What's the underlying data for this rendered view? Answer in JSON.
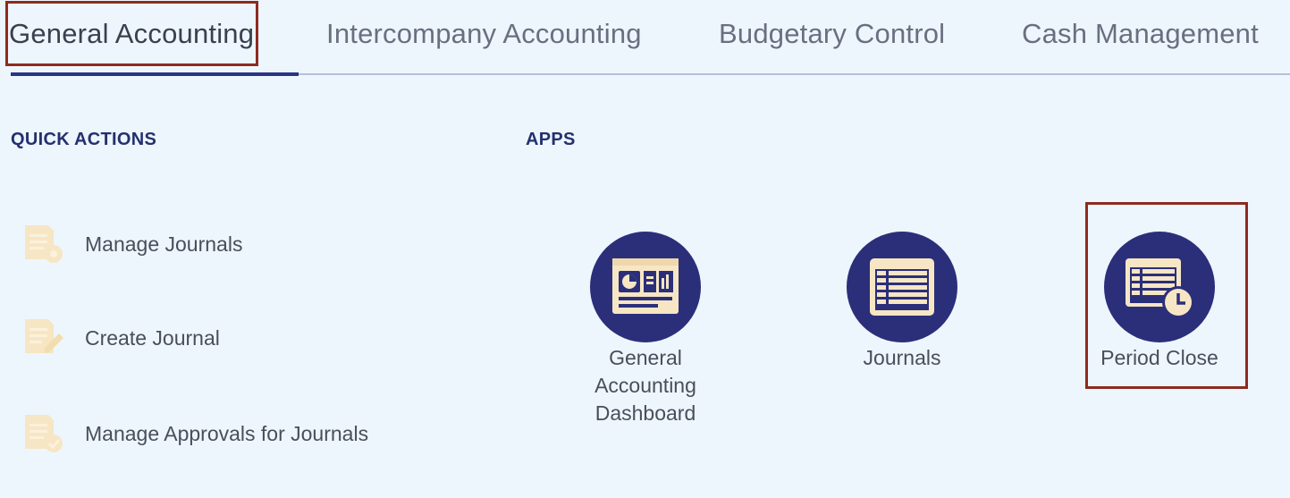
{
  "tabs": [
    {
      "label": "General Accounting",
      "active": true
    },
    {
      "label": "Intercompany Accounting",
      "active": false
    },
    {
      "label": "Budgetary Control",
      "active": false
    },
    {
      "label": "Cash Management",
      "active": false
    }
  ],
  "quick_actions": {
    "title": "QUICK ACTIONS",
    "items": [
      {
        "label": "Manage Journals",
        "icon": "manage-journals-icon"
      },
      {
        "label": "Create Journal",
        "icon": "create-journal-icon"
      },
      {
        "label": "Manage Approvals for Journals",
        "icon": "manage-approvals-icon"
      }
    ]
  },
  "apps": {
    "title": "APPS",
    "items": [
      {
        "label_lines": [
          "General",
          "Accounting",
          "Dashboard"
        ],
        "icon": "dashboard-icon"
      },
      {
        "label_lines": [
          "Journals"
        ],
        "icon": "journals-icon"
      },
      {
        "label_lines": [
          "Period Close"
        ],
        "icon": "period-close-icon"
      }
    ]
  },
  "colors": {
    "background": "#edf6fd",
    "accent": "#2b2f7a",
    "highlight_border": "#8d2b1f",
    "icon_fill": "#f7e6c4"
  }
}
